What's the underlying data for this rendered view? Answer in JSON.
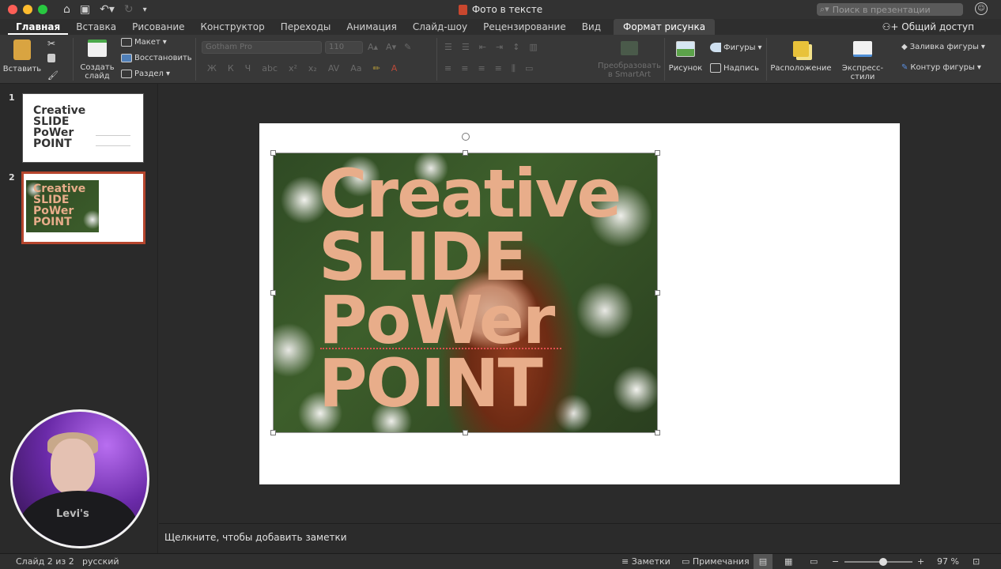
{
  "window": {
    "title": "Фото в тексте",
    "search_placeholder": "Поиск в презентации",
    "share_label": "Общий доступ"
  },
  "colors": {
    "traffic_red": "#fe5f57",
    "traffic_yellow": "#febc2e",
    "traffic_green": "#28c840",
    "accent": "#b5452d",
    "photo_text": "#e8ad8a"
  },
  "tabs": [
    {
      "label": "Главная"
    },
    {
      "label": "Вставка"
    },
    {
      "label": "Рисование"
    },
    {
      "label": "Конструктор"
    },
    {
      "label": "Переходы"
    },
    {
      "label": "Анимация"
    },
    {
      "label": "Слайд-шоу"
    },
    {
      "label": "Рецензирование"
    },
    {
      "label": "Вид"
    },
    {
      "label": "Формат рисунка"
    }
  ],
  "ribbon": {
    "paste": "Вставить",
    "new_slide_line1": "Создать",
    "new_slide_line2": "слайд",
    "layout": "Макет",
    "reset": "Восстановить",
    "section": "Раздел",
    "font_name": "Gotham Pro",
    "font_size": "110",
    "smartart_line1": "Преобразовать",
    "smartart_line2": "в SmartArt",
    "picture": "Рисунок",
    "shapes": "Фигуры",
    "textbox": "Надпись",
    "arrange": "Расположение",
    "quick_styles": "Экспресс-стили",
    "shape_fill": "Заливка фигуры",
    "shape_outline": "Контур фигуры"
  },
  "slides": [
    {
      "number": "1",
      "lines": [
        "Creative",
        "SLIDE",
        "PoWer",
        "POINT"
      ]
    },
    {
      "number": "2",
      "lines": [
        "Creative",
        "SLIDE",
        "PoWer",
        "POINT"
      ]
    }
  ],
  "slide_text": [
    "Creative",
    "SLIDE",
    "PoWer",
    "POINT"
  ],
  "notes_placeholder": "Щелкните, чтобы добавить заметки",
  "status": {
    "slide_count": "Слайд 2 из 2",
    "language": "русский",
    "notes": "Заметки",
    "comments": "Примечания",
    "zoom": "97 %",
    "zoom_level": 0.58
  },
  "webcam": {
    "logo": "Levi's"
  }
}
